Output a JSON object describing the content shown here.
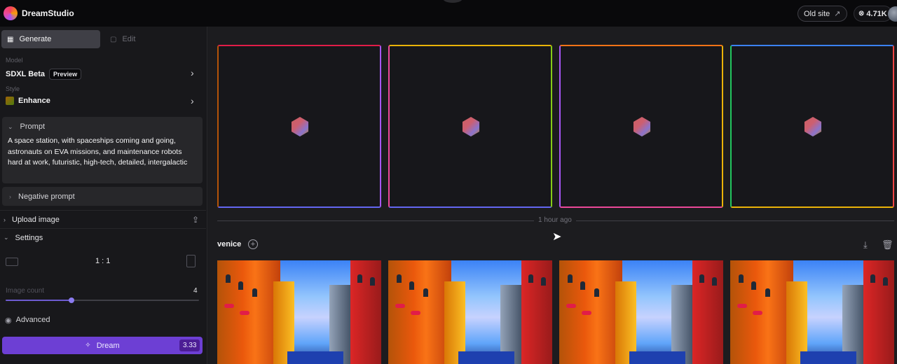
{
  "app": {
    "name": "DreamStudio"
  },
  "topbar": {
    "old_site_label": "Old site",
    "credits": "4.71K"
  },
  "sidebar": {
    "tabs": [
      {
        "label": "Generate",
        "active": true
      },
      {
        "label": "Edit",
        "active": false
      }
    ],
    "model": {
      "label": "Model",
      "value": "SDXL Beta",
      "badge": "Preview"
    },
    "style": {
      "label": "Style",
      "value": "Enhance"
    },
    "prompt": {
      "label": "Prompt",
      "text": "A space station, with spaceships coming and going, astronauts on EVA missions, and maintenance robots hard at work, futuristic, high-tech, detailed, intergalactic"
    },
    "negative_prompt": {
      "label": "Negative prompt"
    },
    "upload_image": {
      "label": "Upload image"
    },
    "settings": {
      "label": "Settings",
      "aspect_ratio": "1 : 1"
    },
    "image_count": {
      "label": "Image count",
      "value": "4",
      "slider_fraction": 0.34
    },
    "advanced": {
      "label": "Advanced"
    },
    "dream_button": {
      "label": "Dream",
      "cost": "3.33"
    }
  },
  "main": {
    "pending_generations": 4,
    "time_separator": "1 hour ago",
    "group": {
      "title": "venice"
    }
  },
  "colors": {
    "accent": "#6d3fd4",
    "background": "#1c1c1f",
    "sidebar": "#18181b"
  }
}
